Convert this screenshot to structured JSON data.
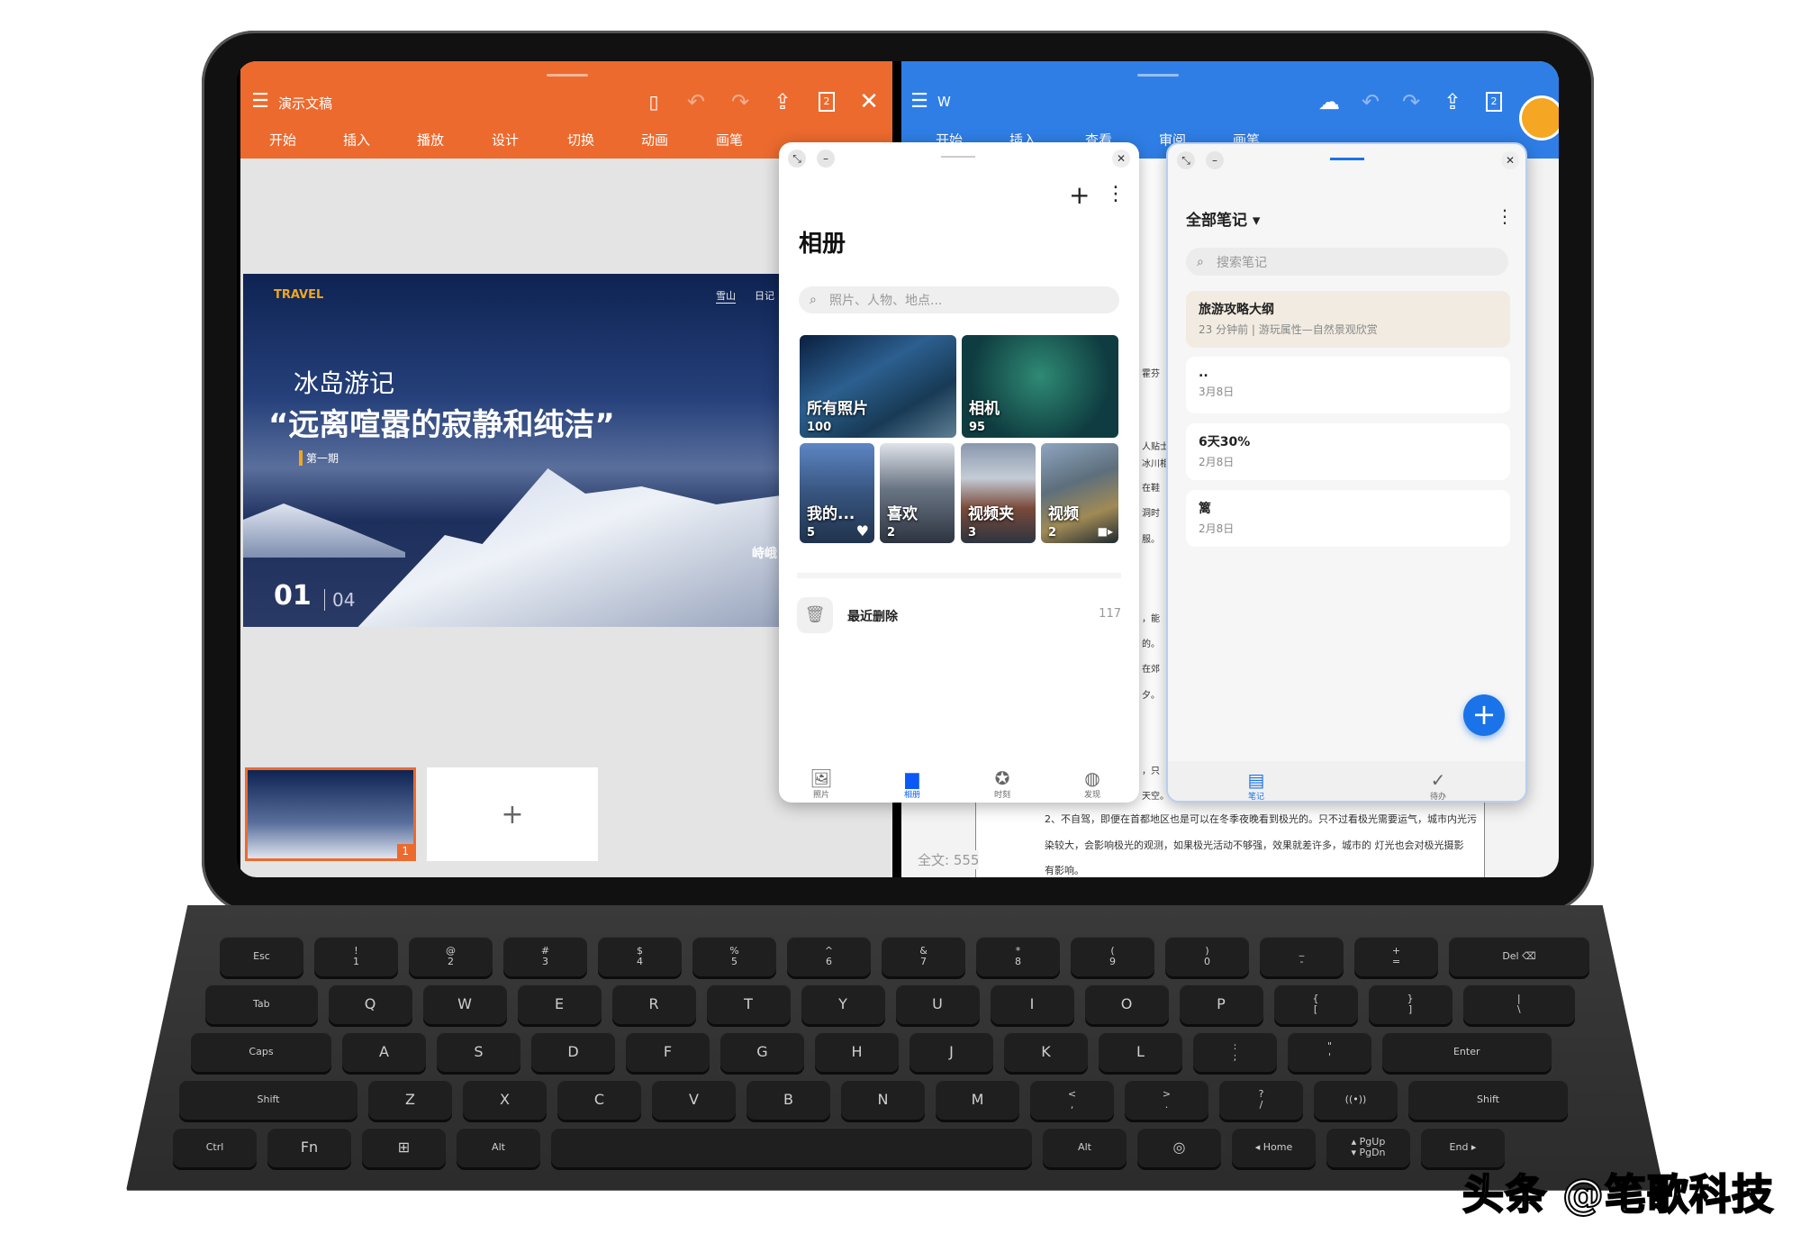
{
  "ppt": {
    "title": "演示文稿",
    "tabs": [
      "开始",
      "插入",
      "播放",
      "设计",
      "切换",
      "动画",
      "画笔"
    ],
    "accent": "#ec6a2e",
    "icons": [
      "save-icon",
      "undo-icon",
      "redo-icon",
      "share-icon",
      "page-count-icon",
      "close-icon"
    ],
    "page_badge": "2",
    "slide": {
      "brand": "TRAVEL",
      "nav": [
        "雪山",
        "日记"
      ],
      "subtitle": "冰岛游记",
      "headline": "“远离喧嚣的寂静和纯洁”",
      "issue": "第一期",
      "index": "01",
      "total": "04",
      "side_title": "峙峨"
    },
    "thumb_number": "1",
    "add_slide": "+"
  },
  "word": {
    "title": "W",
    "tabs": [
      "开始",
      "插入",
      "查看",
      "审阅",
      "画笔"
    ],
    "accent": "#2f7ee6",
    "page_badge": "2",
    "fragments": [
      "霍芬",
      "人贴士",
      "冰川相",
      "在鞋",
      "洞时",
      "服。",
      "，能",
      "的。",
      "在郊",
      "夕。",
      "，只",
      "天空。"
    ],
    "body_lines": [
      "2、不自驾，即便在首都地区也是可以在冬季夜晚看到极光的。只不过看极光需要运气，城市内光污",
      "染较大，会影响极光的观测，如果极光活动不够强，效果就差许多，城市的  灯光也会对极光摄影",
      "有影响。"
    ],
    "word_count": "全文: 555"
  },
  "gallery": {
    "title": "相册",
    "search_placeholder": "照片、人物、地点...",
    "albums": [
      {
        "name": "所有照片",
        "count": "100"
      },
      {
        "name": "相机",
        "count": "95"
      },
      {
        "name": "我的...",
        "count": "5"
      },
      {
        "name": "喜欢",
        "count": "2"
      },
      {
        "name": "视频夹",
        "count": "3"
      },
      {
        "name": "视频",
        "count": "2"
      }
    ],
    "recently_deleted": {
      "label": "最近删除",
      "count": "117"
    },
    "nav": [
      {
        "label": "照片",
        "icon": "photo-icon"
      },
      {
        "label": "相册",
        "icon": "album-icon",
        "active": true
      },
      {
        "label": "时刻",
        "icon": "moments-icon"
      },
      {
        "label": "发现",
        "icon": "discover-icon"
      }
    ],
    "active_color": "#0a59f7"
  },
  "notes": {
    "title": "全部笔记",
    "search_placeholder": "搜索笔记",
    "items": [
      {
        "title": "旅游攻略大纲",
        "meta": "23 分钟前 | 游玩属性—自然景观欣赏",
        "highlight": "#f1ebe1"
      },
      {
        "title": "..",
        "meta": "3月8日"
      },
      {
        "title": "6天30%",
        "meta": "2月8日"
      },
      {
        "title": "篱",
        "meta": "2月8日"
      }
    ],
    "nav": [
      {
        "label": "笔记",
        "icon": "notes-icon",
        "active": true
      },
      {
        "label": "待办",
        "icon": "todo-icon"
      }
    ],
    "fab": "+",
    "fab_color": "#1a73e8"
  },
  "keyboard": {
    "rows": [
      [
        "Esc",
        "!\n1",
        "@\n2",
        "#\n3",
        "$\n4",
        "%\n5",
        "^\n6",
        "&\n7",
        "*\n8",
        "(\n9",
        ")\n0",
        "_\n-",
        "+\n=",
        "Del ⌫"
      ],
      [
        "Tab",
        "Q",
        "W",
        "E",
        "R",
        "T",
        "Y",
        "U",
        "I",
        "O",
        "P",
        "{\n[",
        "}\n]",
        "|\n\\"
      ],
      [
        "Caps",
        "A",
        "S",
        "D",
        "F",
        "G",
        "H",
        "J",
        "K",
        "L",
        ":\n;",
        "\"\n'",
        "Enter"
      ],
      [
        "Shift",
        "Z",
        "X",
        "C",
        "V",
        "B",
        "N",
        "M",
        "<\n,",
        ">\n.",
        "?\n/",
        "((•))",
        "Shift"
      ],
      [
        "Ctrl",
        "Fn",
        "⊞",
        "Alt",
        "",
        "Alt",
        "◎",
        "◂ Home",
        "▴ PgUp\n▾ PgDn",
        "End ▸"
      ]
    ]
  },
  "watermark": "头条 @笔歌科技"
}
